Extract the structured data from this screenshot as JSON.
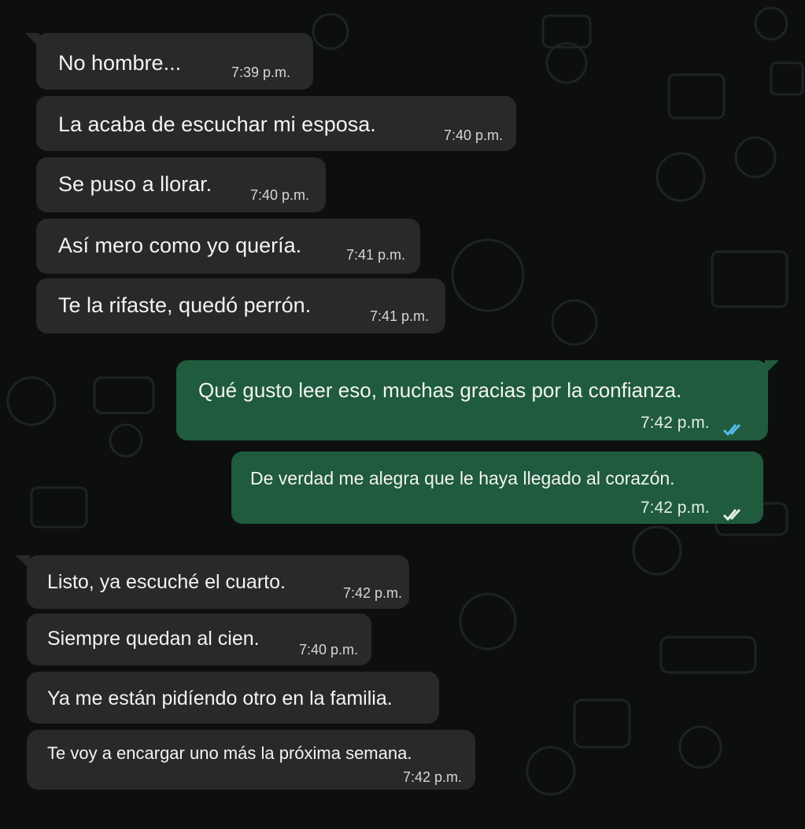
{
  "conversation": {
    "messages": [
      {
        "direction": "incoming",
        "text": "No hombre...",
        "time": "7:39 p.m."
      },
      {
        "direction": "incoming",
        "text": "La acaba de escuchar mi esposa.",
        "time": "7:40 p.m."
      },
      {
        "direction": "incoming",
        "text": "Se puso a llorar.",
        "time": "7:40 p.m."
      },
      {
        "direction": "incoming",
        "text": "Así mero como yo quería.",
        "time": "7:41 p.m."
      },
      {
        "direction": "incoming",
        "text": "Te la rifaste, quedó perrón.",
        "time": "7:41 p.m."
      },
      {
        "direction": "outgoing",
        "text": "Qué gusto leer eso, muchas gracias por la confianza.",
        "time": "7:42 p.m.",
        "status": "read"
      },
      {
        "direction": "outgoing",
        "text": "De verdad me alegra que le haya llegado al corazón.",
        "time": "7:42 p.m.",
        "status": "read"
      },
      {
        "direction": "incoming",
        "text": "Listo, ya escuché el cuarto.",
        "time": "7:42 p.m."
      },
      {
        "direction": "incoming",
        "text": "Siempre quedan al cien.",
        "time": "7:40 p.m."
      },
      {
        "direction": "incoming",
        "text": "Ya me están pidíendo otro en la familia.",
        "time": ""
      },
      {
        "direction": "incoming",
        "text": "Te voy a encargar uno más la próxima semana.",
        "time": "7:42 p.m."
      }
    ]
  },
  "colors": {
    "background": "#0d0f0f",
    "incoming_bubble": "#27292b",
    "outgoing_bubble": "#1f5b3c",
    "read_ticks": "#53bdeb"
  },
  "icons": {
    "read_receipt": "double-check-icon"
  }
}
